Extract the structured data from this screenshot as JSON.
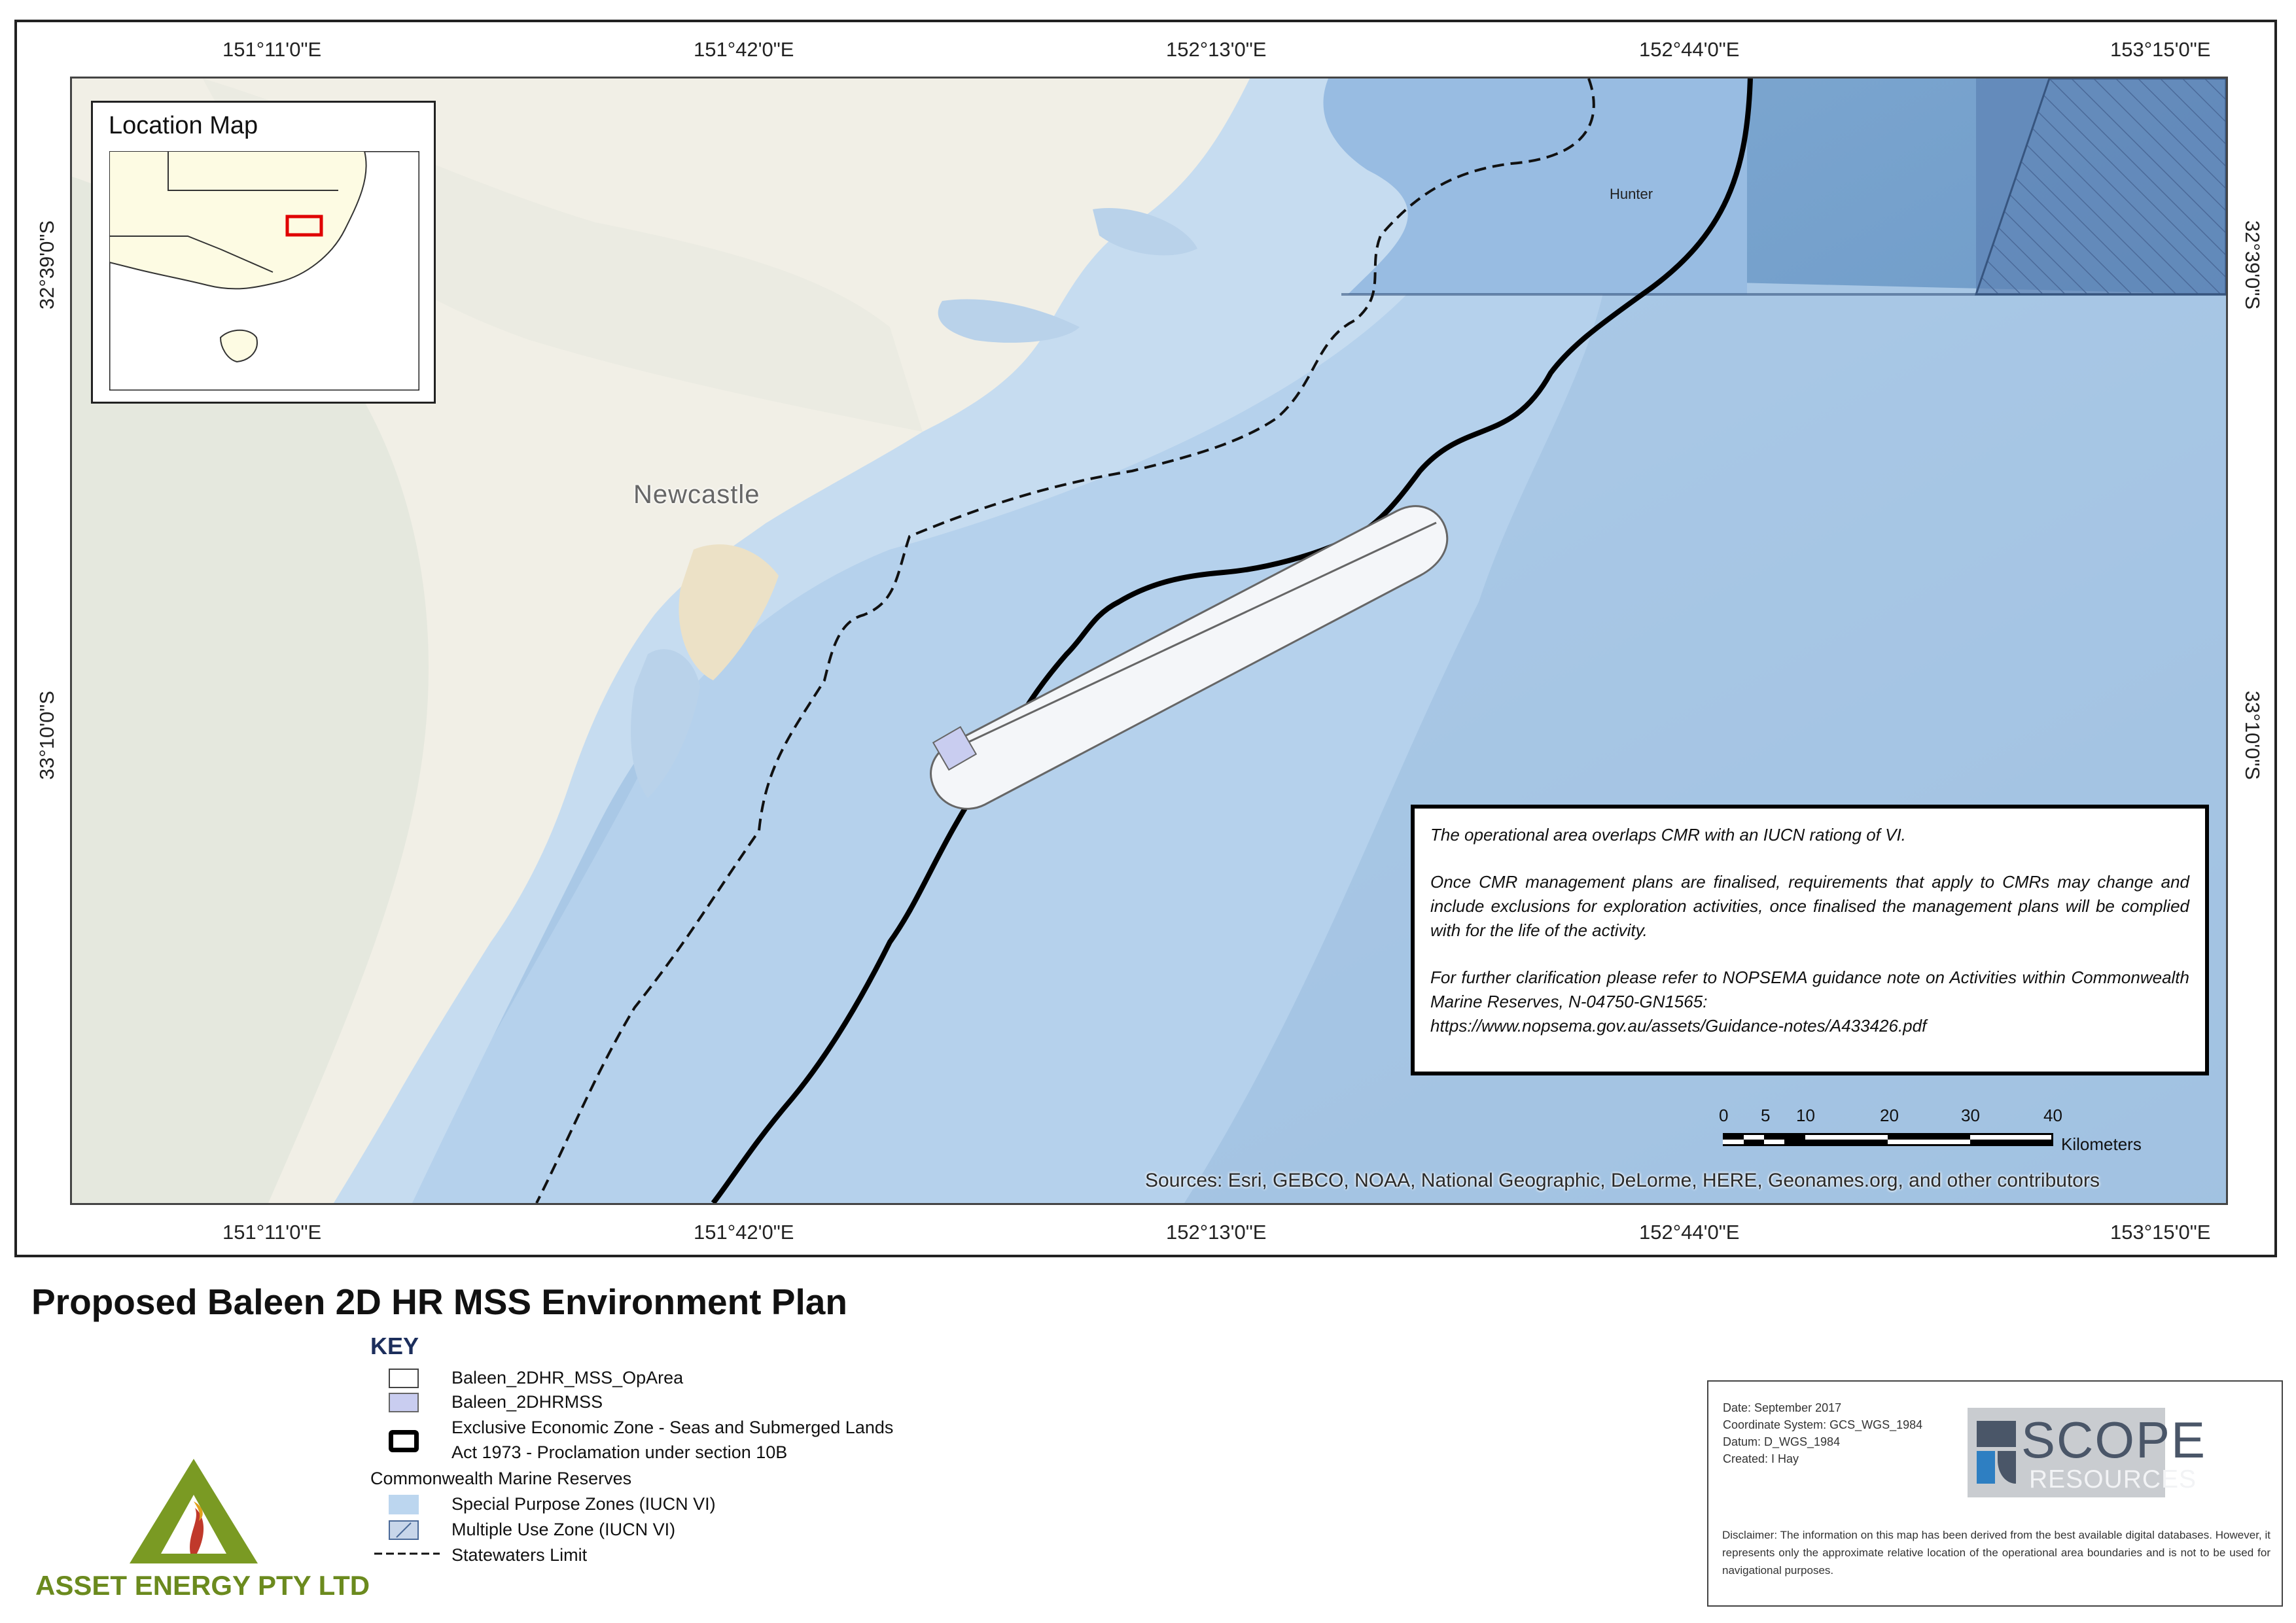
{
  "colors": {
    "land": "#f1efe6",
    "land_relief": "#e4e6dc",
    "ocean_shallow": "#c6dcf0",
    "ocean_deep": "#6e9cc7",
    "cmr_special_purpose": "#bcd6ef",
    "cmr_multiple_use_hatch": "#4b6a99",
    "op_area_fill": "#f4f6f9",
    "mss_fill": "#c9cdf0",
    "eez_line": "#000000",
    "location_box": "#e00000",
    "key_heading": "#1c2e5c",
    "logo_green": "#6b8a1e",
    "scope_logo_bg": "#c9ccd0"
  },
  "map": {
    "top_lon_labels": [
      "151°11'0\"E",
      "151°42'0\"E",
      "152°13'0\"E",
      "152°44'0\"E",
      "153°15'0\"E"
    ],
    "bottom_lon_labels": [
      "151°11'0\"E",
      "151°42'0\"E",
      "152°13'0\"E",
      "152°44'0\"E",
      "153°15'0\"E"
    ],
    "left_lat_labels": [
      "32°39'0\"S",
      "33°10'0\"S"
    ],
    "right_lat_labels": [
      "32°39'0\"S",
      "33°10'0\"S"
    ],
    "place_labels": {
      "newcastle": "Newcastle",
      "hunter": "Hunter"
    },
    "sources": "Sources: Esri, GEBCO, NOAA, National Geographic, DeLorme, HERE, Geonames.org, and other contributors"
  },
  "location_map": {
    "title": "Location Map"
  },
  "notice": {
    "p1": "The operational area overlaps CMR with an IUCN rationg of VI.",
    "p2": "Once CMR management plans are finalised, requirements that apply to CMRs may change and include exclusions for exploration activities, once finalised the management plans will be complied with for the life of the activity.",
    "p3a": "For further clarification please refer to NOPSEMA guidance note on Activities within Commonwealth Marine Reserves, N-04750-GN1565:",
    "p3b": "https://www.nopsema.gov.au/assets/Guidance-notes/A433426.pdf"
  },
  "scale_bar": {
    "ticks": [
      "0",
      "5",
      "10",
      "20",
      "30",
      "40"
    ],
    "unit": "Kilometers"
  },
  "title": "Proposed Baleen 2D HR MSS Environment Plan",
  "key": {
    "heading": "KEY",
    "op_area": "Baleen_2DHR_MSS_OpArea",
    "mss": "Baleen_2DHRMSS",
    "eez_line1": "Exclusive Economic Zone - Seas and Submerged Lands",
    "eez_line2": "Act 1973 - Proclamation under section 10B",
    "cmr_heading": "Commonwealth Marine Reserves",
    "special_purpose": "Special Purpose Zones (IUCN VI)",
    "multiple_use": "Multiple Use Zone (IUCN VI)",
    "statewaters": "Statewaters Limit"
  },
  "logo": {
    "company": "ASSET ENERGY PTY LTD"
  },
  "info": {
    "date": "Date: September 2017",
    "coord_system": "Coordinate System: GCS_WGS_1984",
    "datum": "Datum: D_WGS_1984",
    "created": "Created: I Hay",
    "disclaimer": "Disclaimer: The information on this map has been derived from the best available digital databases. However, it represents only the approximate relative location of the operational area boundaries and is not to be used for navigational purposes.",
    "scope_line1": "SCOPE",
    "scope_line2": "RESOURCES"
  }
}
